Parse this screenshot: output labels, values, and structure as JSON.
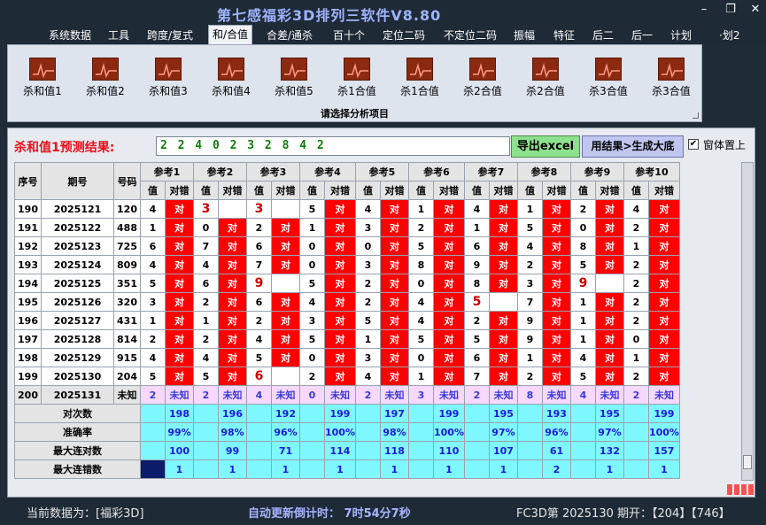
{
  "window": {
    "title": "第七感福彩3D排列三软件V8.80",
    "buttons": [
      "–",
      "❐",
      "✕"
    ]
  },
  "menu": {
    "items": [
      "系统数据",
      "工具",
      "跨度/复式",
      "和/合值",
      "合差/通杀",
      "百十个",
      "定位二码",
      "不定位二码",
      "振幅",
      "特征",
      "后二",
      "后一",
      "计划",
      "·划2"
    ],
    "active": "和/合值"
  },
  "ribbon": {
    "buttons": [
      "杀和值1",
      "杀和值2",
      "杀和值3",
      "杀和值4",
      "杀和值5",
      "杀1合值",
      "杀1合值",
      "杀2合值",
      "杀2合值",
      "杀3合值",
      "杀3合值"
    ],
    "icon": "chart-icon",
    "caption": "请选择分析项目"
  },
  "prediction": {
    "label": "杀和值1预测结果:",
    "value": "2 2 4 0 2 3 2 8 4 2",
    "export_button": "导出excel",
    "generate_button": "用结果>生成大底",
    "pin_checkbox": {
      "checked": true,
      "label": "窗体置上"
    }
  },
  "grid": {
    "headers": {
      "seq": "序号",
      "period": "期号",
      "number": "号码"
    },
    "ref_headers": [
      "参考1",
      "参考2",
      "参考3",
      "参考4",
      "参考5",
      "参考6",
      "参考7",
      "参考8",
      "参考9",
      "参考10"
    ],
    "sub_headers": [
      "值",
      "对错"
    ],
    "mark_text": "对",
    "rows": [
      {
        "seq": "190",
        "period": "2025121",
        "number": "120",
        "vals": [
          "4",
          "3",
          "3",
          "5",
          "4",
          "1",
          "4",
          "1",
          "2",
          "4"
        ],
        "ok": [
          1,
          0,
          0,
          1,
          1,
          1,
          1,
          1,
          1,
          1
        ]
      },
      {
        "seq": "191",
        "period": "2025122",
        "number": "488",
        "vals": [
          "1",
          "0",
          "2",
          "1",
          "3",
          "2",
          "1",
          "5",
          "0",
          "2"
        ],
        "ok": [
          1,
          1,
          1,
          1,
          1,
          1,
          1,
          1,
          1,
          1
        ]
      },
      {
        "seq": "192",
        "period": "2025123",
        "number": "725",
        "vals": [
          "6",
          "7",
          "6",
          "0",
          "0",
          "5",
          "6",
          "4",
          "8",
          "1"
        ],
        "ok": [
          1,
          1,
          1,
          1,
          1,
          1,
          1,
          1,
          1,
          1
        ]
      },
      {
        "seq": "193",
        "period": "2025124",
        "number": "809",
        "vals": [
          "4",
          "4",
          "7",
          "0",
          "3",
          "8",
          "9",
          "2",
          "5",
          "2"
        ],
        "ok": [
          1,
          1,
          1,
          1,
          1,
          1,
          1,
          1,
          1,
          1
        ]
      },
      {
        "seq": "194",
        "period": "2025125",
        "number": "351",
        "vals": [
          "5",
          "6",
          "9",
          "5",
          "2",
          "0",
          "8",
          "3",
          "9",
          "2"
        ],
        "ok": [
          1,
          1,
          0,
          1,
          1,
          1,
          1,
          1,
          0,
          1
        ]
      },
      {
        "seq": "195",
        "period": "2025126",
        "number": "320",
        "vals": [
          "3",
          "2",
          "6",
          "4",
          "2",
          "4",
          "5",
          "7",
          "1",
          "2"
        ],
        "ok": [
          1,
          1,
          1,
          1,
          1,
          1,
          0,
          1,
          1,
          1
        ]
      },
      {
        "seq": "196",
        "period": "2025127",
        "number": "431",
        "vals": [
          "1",
          "1",
          "2",
          "3",
          "5",
          "4",
          "2",
          "9",
          "1",
          "2"
        ],
        "ok": [
          1,
          1,
          1,
          1,
          1,
          1,
          1,
          1,
          1,
          1
        ]
      },
      {
        "seq": "197",
        "period": "2025128",
        "number": "814",
        "vals": [
          "2",
          "2",
          "4",
          "5",
          "1",
          "5",
          "5",
          "9",
          "1",
          "0"
        ],
        "ok": [
          1,
          1,
          1,
          1,
          1,
          1,
          1,
          1,
          1,
          1
        ]
      },
      {
        "seq": "198",
        "period": "2025129",
        "number": "915",
        "vals": [
          "4",
          "4",
          "5",
          "0",
          "3",
          "0",
          "6",
          "1",
          "4",
          "1"
        ],
        "ok": [
          1,
          1,
          1,
          1,
          1,
          1,
          1,
          1,
          1,
          1
        ]
      },
      {
        "seq": "199",
        "period": "2025130",
        "number": "204",
        "vals": [
          "5",
          "5",
          "6",
          "2",
          "4",
          "1",
          "7",
          "2",
          "5",
          "2"
        ],
        "ok": [
          1,
          1,
          0,
          1,
          1,
          1,
          1,
          1,
          1,
          1
        ]
      }
    ],
    "pending": {
      "seq": "200",
      "period": "2025131",
      "number": "未知",
      "vals": [
        "2",
        "2",
        "4",
        "0",
        "2",
        "3",
        "2",
        "8",
        "4",
        "2"
      ],
      "status": "未知"
    },
    "stats": [
      {
        "label": "对次数",
        "values": [
          "198",
          "196",
          "192",
          "199",
          "197",
          "199",
          "195",
          "193",
          "195",
          "199"
        ]
      },
      {
        "label": "准确率",
        "values": [
          "99%",
          "98%",
          "96%",
          "100%",
          "98%",
          "100%",
          "97%",
          "96%",
          "97%",
          "100%"
        ]
      },
      {
        "label": "最大连对数",
        "values": [
          "100",
          "99",
          "71",
          "114",
          "118",
          "110",
          "107",
          "61",
          "132",
          "157"
        ]
      },
      {
        "label": "最大连错数",
        "values": [
          "1",
          "1",
          "1",
          "1",
          "1",
          "1",
          "1",
          "2",
          "1",
          "1"
        ]
      }
    ]
  },
  "status_bar": {
    "current_data": "当前数据为：[福彩3D]",
    "countdown": "自动更新倒计时：  7时54分7秒",
    "info": "FC3D第 2025130 期开：【204】【746】"
  },
  "colors": {
    "hit": "#ff0000",
    "miss": "#ffffff",
    "pending": "#f7d8ff",
    "stats": "#7ff7ff"
  }
}
